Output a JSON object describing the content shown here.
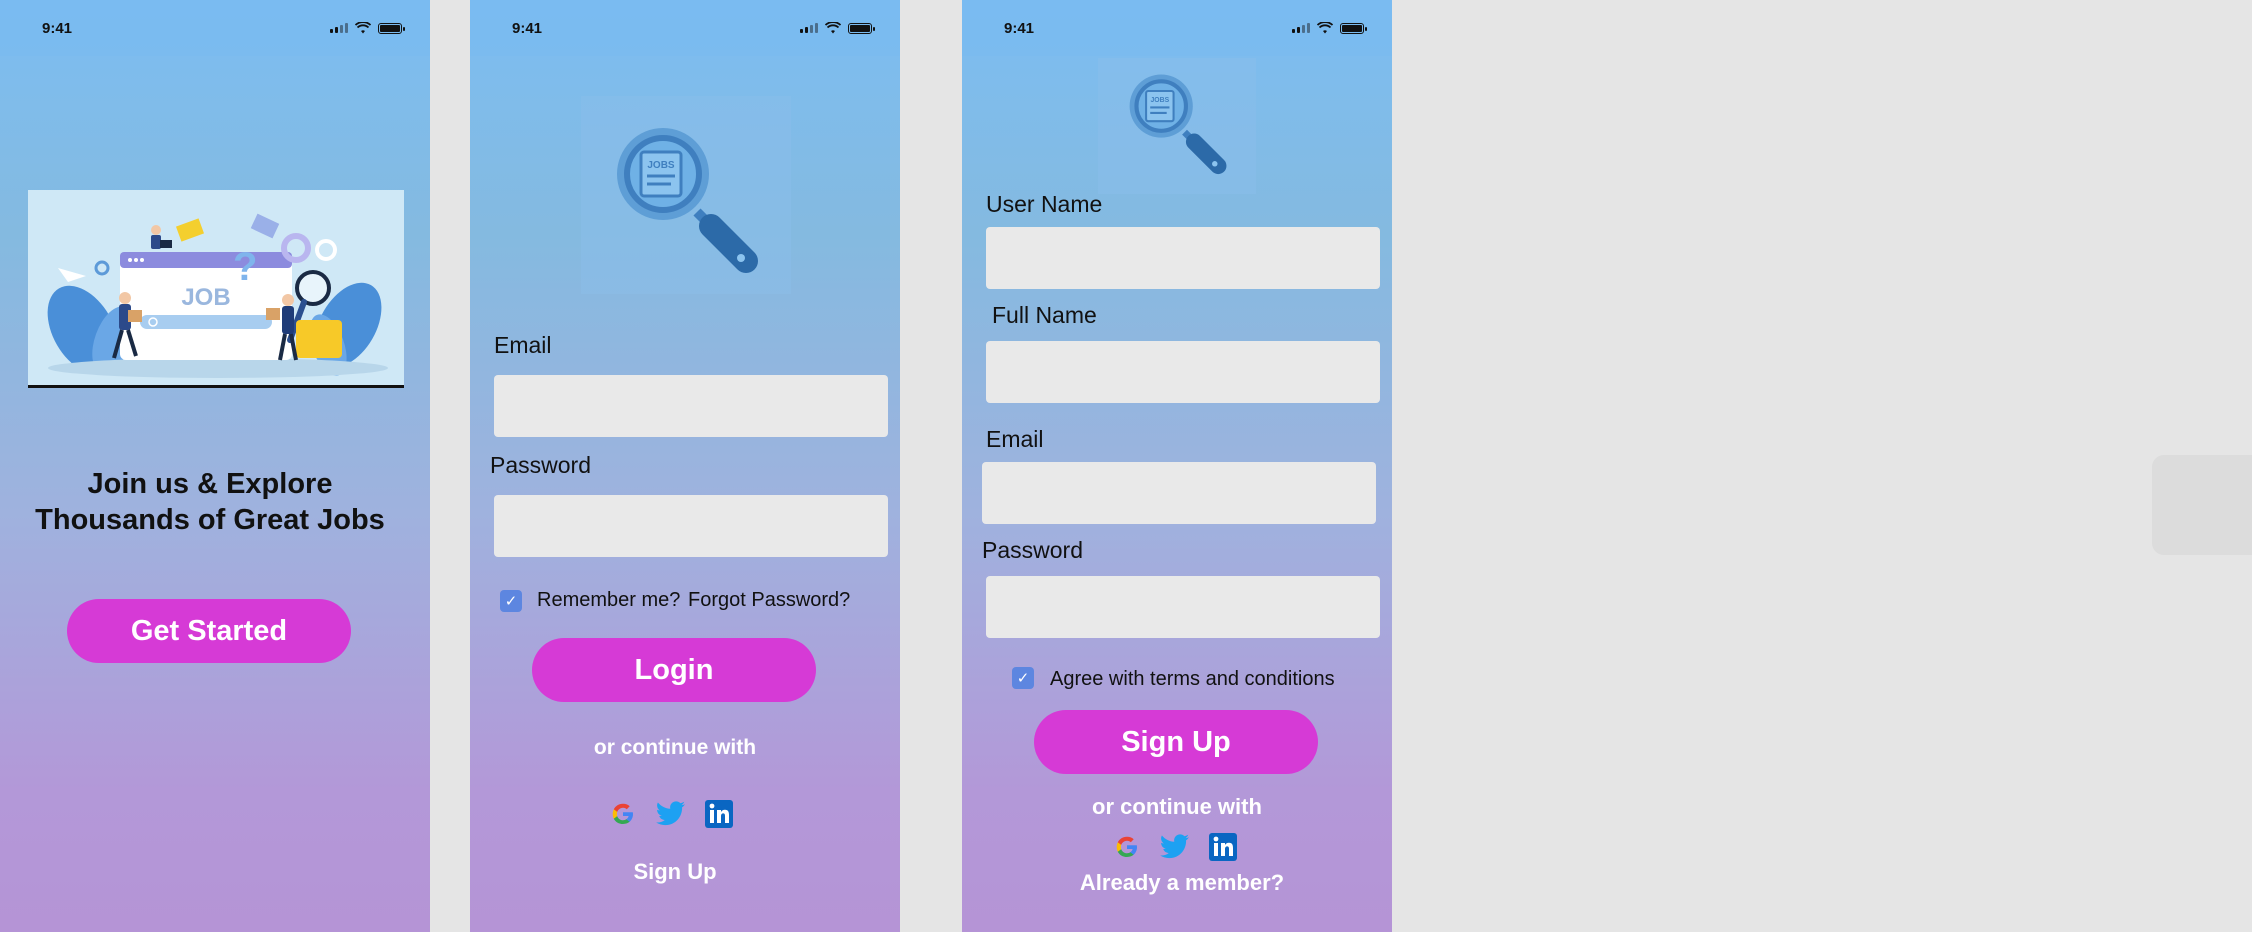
{
  "status_time": "9:41",
  "onboarding": {
    "headline_line1": "Join us & Explore",
    "headline_line2": "Thousands of Great Jobs",
    "hero_label": "JOB",
    "cta": "Get Started"
  },
  "login": {
    "email_label": "Email",
    "password_label": "Password",
    "remember": "Remember me?",
    "forgot": "Forgot Password?",
    "login_button": "Login",
    "continue_with": "or continue with",
    "signup_link": "Sign Up",
    "logo_text": "JOBS"
  },
  "signup": {
    "username_label": "User Name",
    "fullname_label": "Full Name",
    "email_label": "Email",
    "password_label": "Password",
    "agree": "Agree with terms and conditions",
    "signup_button": "Sign Up",
    "continue_with": "or continue with",
    "member_link": "Already a member?",
    "logo_text": "JOBS"
  },
  "icons": [
    "google-icon",
    "twitter-icon",
    "linkedin-icon",
    "checkmark-icon",
    "magnifier-icon"
  ],
  "colors": {
    "accent": "#d63ad6",
    "checkbox": "#5d86e0",
    "field": "#e9e9e9"
  }
}
